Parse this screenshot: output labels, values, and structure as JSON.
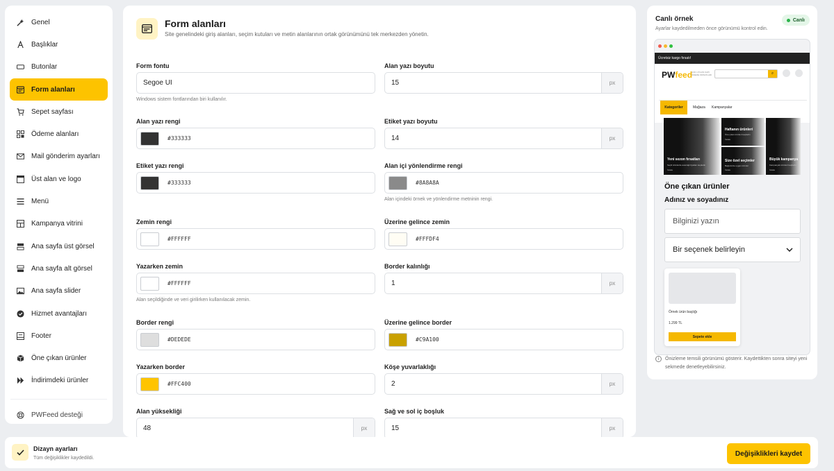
{
  "sidebar": {
    "items": [
      {
        "label": "Genel",
        "icon": "magic-wand-icon"
      },
      {
        "label": "Başlıklar",
        "icon": "text-icon"
      },
      {
        "label": "Butonlar",
        "icon": "button-icon"
      },
      {
        "label": "Form alanları",
        "icon": "form-icon",
        "active": true
      },
      {
        "label": "Sepet sayfası",
        "icon": "cart-icon"
      },
      {
        "label": "Ödeme alanları",
        "icon": "grid-icon"
      },
      {
        "label": "Mail gönderim ayarları",
        "icon": "mail-icon"
      },
      {
        "label": "Üst alan ve logo",
        "icon": "window-icon"
      },
      {
        "label": "Menü",
        "icon": "menu-icon"
      },
      {
        "label": "Kampanya vitrini",
        "icon": "layout-icon"
      },
      {
        "label": "Ana sayfa üst görsel",
        "icon": "stack-icon"
      },
      {
        "label": "Ana sayfa alt görsel",
        "icon": "stack-icon"
      },
      {
        "label": "Ana sayfa slider",
        "icon": "image-icon"
      },
      {
        "label": "Hizmet avantajları",
        "icon": "check-circle-icon"
      },
      {
        "label": "Footer",
        "icon": "footer-icon"
      },
      {
        "label": "Öne çıkan ürünler",
        "icon": "box-icon"
      },
      {
        "label": "İndirimdeki ürünler",
        "icon": "skip-icon"
      }
    ],
    "support": {
      "label": "PWFeed desteği",
      "icon": "lifebuoy-icon"
    }
  },
  "main": {
    "title": "Form alanları",
    "subtitle": "Site genelindeki giriş alanları, seçim kutuları ve metin alanlarının ortak görünümünü tek merkezden yönetin.",
    "fields": {
      "form_font": {
        "label": "Form fontu",
        "value": "Segoe UI",
        "help": "Windows sistem fontlarından biri kullanılır."
      },
      "field_font_size": {
        "label": "Alan yazı boyutu",
        "value": "15",
        "unit": "px"
      },
      "field_text_color": {
        "label": "Alan yazı rengi",
        "value": "#333333"
      },
      "label_font_size": {
        "label": "Etiket yazı boyutu",
        "value": "14",
        "unit": "px"
      },
      "label_text_color": {
        "label": "Etiket yazı rengi",
        "value": "#333333"
      },
      "placeholder_color": {
        "label": "Alan içi yönlendirme rengi",
        "value": "#8A8A8A",
        "help": "Alan içindeki örnek ve yönlendirme metninin rengi."
      },
      "bg_color": {
        "label": "Zemin rengi",
        "value": "#FFFFFF"
      },
      "hover_bg": {
        "label": "Üzerine gelince zemin",
        "value": "#FFFDF4"
      },
      "typing_bg": {
        "label": "Yazarken zemin",
        "value": "#FFFFFF",
        "help": "Alan seçildiğinde ve veri girilirken kullanılacak zemin."
      },
      "border_width": {
        "label": "Border kalınlığı",
        "value": "1",
        "unit": "px"
      },
      "border_color": {
        "label": "Border rengi",
        "value": "#DEDEDE"
      },
      "hover_border": {
        "label": "Üzerine gelince border",
        "value": "#C9A100"
      },
      "typing_border": {
        "label": "Yazarken border",
        "value": "#FFC400"
      },
      "corner_radius": {
        "label": "Köşe yuvarlaklığı",
        "value": "2",
        "unit": "px"
      },
      "field_height": {
        "label": "Alan yüksekliği",
        "value": "48",
        "unit": "px"
      },
      "horizontal_padding": {
        "label": "Sağ ve sol iç boşluk",
        "value": "15",
        "unit": "px"
      }
    }
  },
  "preview": {
    "title": "Canlı örnek",
    "subtitle": "Ayarlar kaydedilmeden önce görünümü kontrol edin.",
    "badge": "Canlı",
    "promo": "Ücretsiz kargo fırsatı!",
    "logo_a": "PW",
    "logo_b": "feed",
    "tagline": "ÇOK UYGUN KAPI ÖDEME FIRSATLARI",
    "tabs": [
      "Kategoriler",
      "Mağaza",
      "Kampanyalar"
    ],
    "banners": [
      {
        "title": "Yeni sezon fırsatları",
        "sub": "Seçili ürünlerde avantajlı fiyatları keşfedin",
        "cta": "İncele"
      },
      {
        "title": "Haftanın ürünleri",
        "sub": "Öne çıkan ürünleri keşfedin",
        "cta": "İncele"
      },
      {
        "title": "Size özel seçimler",
        "sub": "Beğeninize uygun ürünler",
        "cta": "İncele"
      },
      {
        "title": "Büyük kampanya",
        "sub": "Kampanyalı ürünleri keşfedin",
        "cta": "İncele"
      }
    ],
    "section_title": "Öne çıkan ürünler",
    "form_label": "Adınız ve soyadınız",
    "input_placeholder": "Bilginizi yazın",
    "select_value": "Bir seçenek belirleyin",
    "card_name": "Örnek ürün başlığı",
    "card_price": "1.299 TL",
    "card_button": "Sepete ekle",
    "note": "Önizleme temsili görünümü gösterir. Kaydettikten sonra siteyi yeni sekmede denetleyebilirsiniz."
  },
  "bottom": {
    "title": "Dizayn ayarları",
    "subtitle": "Tüm değişiklikler kaydedildi.",
    "save_label": "Değişiklikleri kaydet"
  },
  "colors": {
    "accent": "#FDC300",
    "live_green": "#2BB34A"
  }
}
